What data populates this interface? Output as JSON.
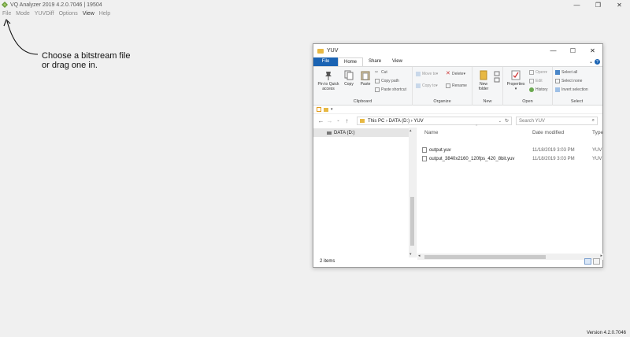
{
  "app": {
    "title": "VQ Analyzer 2019 4.2.0.7046  |  19504",
    "window_controls": [
      "—",
      "❐",
      "✕"
    ],
    "menu": [
      {
        "label": "File"
      },
      {
        "label": "Mode"
      },
      {
        "label": "YUVDiff"
      },
      {
        "label": "Options"
      },
      {
        "label": "View"
      },
      {
        "label": "Help"
      }
    ],
    "hint": "Choose a bitstream file\nor drag one in.",
    "version": "Version 4.2.0.7046",
    "colors": {
      "background": "#f0f0f0",
      "logo": "#6a9b3d"
    }
  },
  "explorer": {
    "title": "YUV",
    "controls": [
      "—",
      "☐",
      "✕"
    ],
    "tabs": {
      "file": "File",
      "home": "Home",
      "share": "Share",
      "view": "View"
    },
    "ribbon": {
      "clipboard": {
        "pin": "Pin to Quick access",
        "copy": "Copy",
        "paste": "Paste",
        "cut": "Cut",
        "copy_path": "Copy path",
        "paste_shortcut": "Paste shortcut",
        "label": "Clipboard"
      },
      "organize": {
        "move_to": "Move to",
        "copy_to": "Copy to",
        "delete": "Delete",
        "rename": "Rename",
        "label": "Organize"
      },
      "new": {
        "new_folder": "New folder",
        "label": "New"
      },
      "open": {
        "properties": "Properties",
        "open": "Open",
        "edit": "Edit",
        "history": "History",
        "label": "Open"
      },
      "select": {
        "select_all": "Select all",
        "select_none": "Select none",
        "invert": "Invert selection",
        "label": "Select"
      }
    },
    "address": {
      "breadcrumb": "This PC  ›  DATA (D:)  ›  YUV",
      "search_placeholder": "Search YUV"
    },
    "nav": {
      "drive": "DATA (D:)"
    },
    "columns": {
      "name": "Name",
      "date": "Date modified",
      "type": "Type"
    },
    "files": [
      {
        "name": "output.yuv",
        "date": "11/18/2019 3:03 PM",
        "type": "YUV"
      },
      {
        "name": "output_3840x2160_120fps_420_8bit.yuv",
        "date": "11/18/2019 3:03 PM",
        "type": "YUV"
      }
    ],
    "status": "2 items",
    "colors": {
      "accent": "#1a63b3",
      "folder": "#e7b843"
    }
  }
}
